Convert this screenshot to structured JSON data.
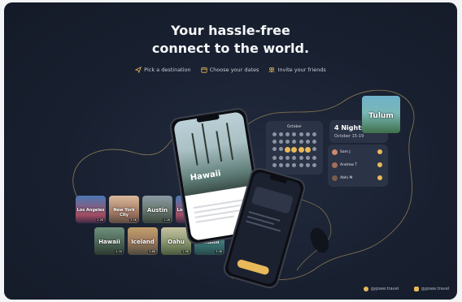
{
  "hero": {
    "title_line1": "Your hassle-free",
    "title_line2": "connect to the world."
  },
  "steps": [
    {
      "icon": "paper-plane-icon",
      "label": "Pick a destination"
    },
    {
      "icon": "calendar-icon",
      "label": "Choose your dates"
    },
    {
      "icon": "people-icon",
      "label": "Invite your friends"
    }
  ],
  "destinations_row1": [
    {
      "name": "Los Angeles",
      "tag": "2.2K"
    },
    {
      "name": "New York City",
      "tag": "3.5K"
    },
    {
      "name": "Austin",
      "tag": "1.2K"
    },
    {
      "name": "Los Angeles",
      "tag": "2.2K"
    }
  ],
  "destinations_row2": [
    {
      "name": "Hawaii",
      "tag": "4.1K"
    },
    {
      "name": "Iceland",
      "tag": "2.6K"
    },
    {
      "name": "Oahu",
      "tag": "1.9K"
    },
    {
      "name": "Miami",
      "tag": "3.0K"
    }
  ],
  "main_phone": {
    "heading": "Hawaii"
  },
  "calendar": {
    "month": "October"
  },
  "trip": {
    "nights": "4 Nights",
    "dates": "October 15-19"
  },
  "tulum": {
    "label": "Tulum"
  },
  "friends": [
    {
      "name": "Sam J"
    },
    {
      "name": "Andrew T"
    },
    {
      "name": "Abhi M"
    }
  ],
  "footer": {
    "left_handle": "gypsee.travel",
    "right_handle": "gypsee.travel"
  },
  "colors": {
    "background": "#182030",
    "accent_gold": "#e8b95a",
    "panel": "#2b3346"
  }
}
